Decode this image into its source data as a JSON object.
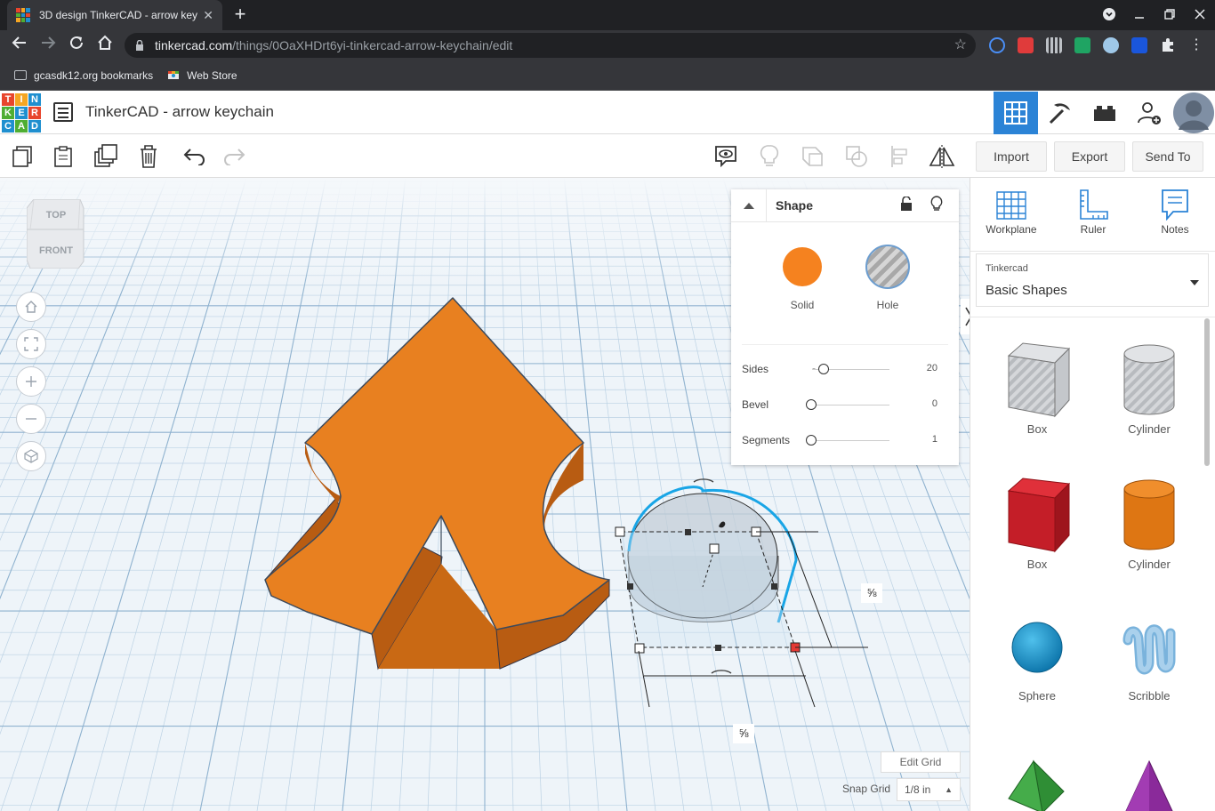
{
  "browser": {
    "tab_title": "3D design TinkerCAD - arrow key",
    "tab_close": "✕",
    "new_tab": "+",
    "url_host": "tinkercad.com",
    "url_path": "/things/0OaXHDrt6yi-tinkercad-arrow-keychain/edit",
    "bookmarks": [
      "gcasdk12.org bookmarks",
      "Web Store"
    ]
  },
  "app": {
    "logo_letters": [
      "T",
      "I",
      "N",
      "K",
      "E",
      "R",
      "C",
      "A",
      "D"
    ],
    "doc_title": "TinkerCAD - arrow keychain"
  },
  "toolbar": {
    "import_label": "Import",
    "export_label": "Export",
    "sendto_label": "Send To"
  },
  "viewcube": {
    "top": "TOP",
    "front": "FRONT"
  },
  "shape_panel": {
    "title": "Shape",
    "solid_label": "Solid",
    "hole_label": "Hole",
    "solid_color": "#f5821f",
    "params": [
      {
        "label": "Sides",
        "value": "20",
        "min_label": "-"
      },
      {
        "label": "Bevel",
        "value": "0"
      },
      {
        "label": "Segments",
        "value": "1"
      }
    ]
  },
  "viewport": {
    "dim_label_right": "⅝",
    "dim_label_bottom": "⅝",
    "edit_grid": "Edit Grid",
    "snap_grid_label": "Snap Grid",
    "snap_grid_value": "1/8 in",
    "arrow_color": "#e88020"
  },
  "right_panel": {
    "tools": [
      "Workplane",
      "Ruler",
      "Notes"
    ],
    "library_source": "Tinkercad",
    "library_name": "Basic Shapes",
    "shapes": [
      "Box",
      "Cylinder",
      "Box",
      "Cylinder",
      "Sphere",
      "Scribble"
    ]
  }
}
